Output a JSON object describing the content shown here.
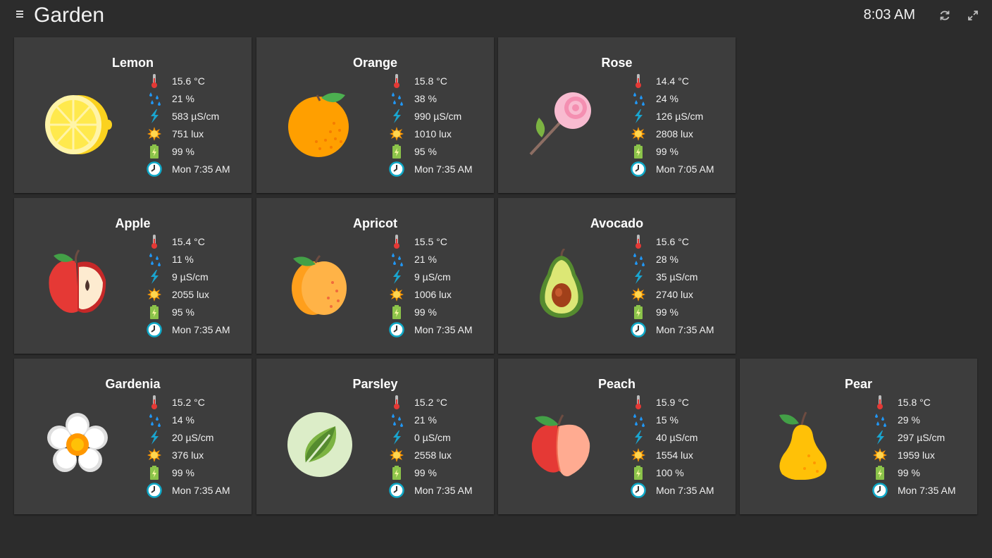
{
  "header": {
    "title": "Garden",
    "time": "8:03 AM",
    "menu_icon": "hamburger-icon",
    "refresh_icon": "refresh-icon",
    "fullscreen_icon": "fullscreen-icon"
  },
  "metric_icons": [
    "thermometer-icon",
    "droplets-icon",
    "lightning-icon",
    "sun-icon",
    "battery-icon",
    "clock-icon"
  ],
  "plants": [
    {
      "name": "Lemon",
      "icon": "lemon-icon",
      "temperature": "15.6 °C",
      "moisture": "21 %",
      "conductivity": "583 µS/cm",
      "light": "751 lux",
      "battery": "99 %",
      "updated": "Mon 7:35 AM"
    },
    {
      "name": "Orange",
      "icon": "orange-icon",
      "temperature": "15.8 °C",
      "moisture": "38 %",
      "conductivity": "990 µS/cm",
      "light": "1010 lux",
      "battery": "95 %",
      "updated": "Mon 7:35 AM"
    },
    {
      "name": "Rose",
      "icon": "rose-icon",
      "temperature": "14.4 °C",
      "moisture": "24 %",
      "conductivity": "126 µS/cm",
      "light": "2808 lux",
      "battery": "99 %",
      "updated": "Mon 7:05 AM"
    },
    {
      "name": "Apple",
      "icon": "apple-icon",
      "temperature": "15.4 °C",
      "moisture": "11 %",
      "conductivity": "9 µS/cm",
      "light": "2055 lux",
      "battery": "95 %",
      "updated": "Mon 7:35 AM"
    },
    {
      "name": "Apricot",
      "icon": "apricot-icon",
      "temperature": "15.5 °C",
      "moisture": "21 %",
      "conductivity": "9 µS/cm",
      "light": "1006 lux",
      "battery": "99 %",
      "updated": "Mon 7:35 AM"
    },
    {
      "name": "Avocado",
      "icon": "avocado-icon",
      "temperature": "15.6 °C",
      "moisture": "28 %",
      "conductivity": "35 µS/cm",
      "light": "2740 lux",
      "battery": "99 %",
      "updated": "Mon 7:35 AM"
    },
    {
      "name": "Gardenia",
      "icon": "gardenia-flower-icon",
      "temperature": "15.2 °C",
      "moisture": "14 %",
      "conductivity": "20 µS/cm",
      "light": "376 lux",
      "battery": "99 %",
      "updated": "Mon 7:35 AM"
    },
    {
      "name": "Parsley",
      "icon": "parsley-leaf-icon",
      "temperature": "15.2 °C",
      "moisture": "21 %",
      "conductivity": "0 µS/cm",
      "light": "2558 lux",
      "battery": "99 %",
      "updated": "Mon 7:35 AM"
    },
    {
      "name": "Peach",
      "icon": "peach-icon",
      "temperature": "15.9 °C",
      "moisture": "15 %",
      "conductivity": "40 µS/cm",
      "light": "1554 lux",
      "battery": "100 %",
      "updated": "Mon 7:35 AM"
    },
    {
      "name": "Pear",
      "icon": "pear-icon",
      "temperature": "15.8 °C",
      "moisture": "29 %",
      "conductivity": "297 µS/cm",
      "light": "1959 lux",
      "battery": "99 %",
      "updated": "Mon 7:35 AM"
    }
  ],
  "colors": {
    "background": "#2c2c2c",
    "card": "#3d3d3d",
    "thermometer": "#e53935",
    "water": "#2196f3",
    "lightning": "#1aa5cf",
    "sun": "#ffb300",
    "battery": "#8bc34a",
    "clock": "#0fa9c8"
  }
}
